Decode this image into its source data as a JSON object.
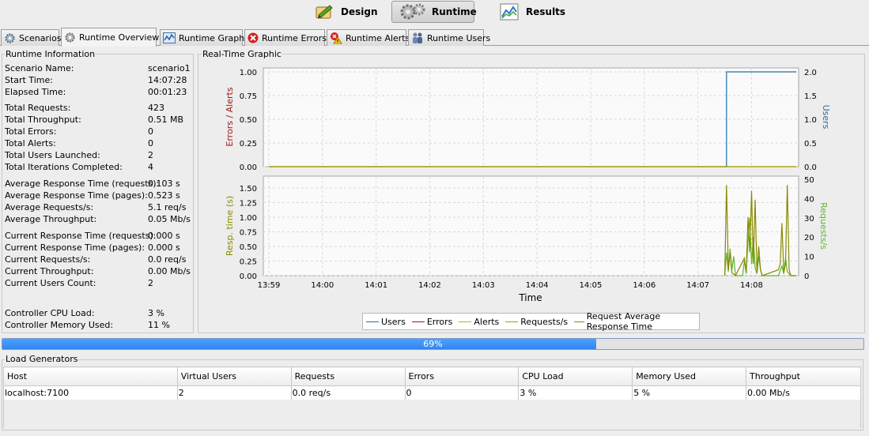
{
  "modes": [
    {
      "label": "Design",
      "icon": "design-icon",
      "active": false
    },
    {
      "label": "Runtime",
      "icon": "gears-icon",
      "active": true
    },
    {
      "label": "Results",
      "icon": "chart-icon",
      "active": false
    }
  ],
  "tabs": [
    {
      "label": "Scenarios",
      "icon": "gear-icon"
    },
    {
      "label": "Runtime Overview",
      "icon": "gear-icon",
      "active": true
    },
    {
      "label": "Runtime Graphs",
      "icon": "graph-icon"
    },
    {
      "label": "Runtime Errors",
      "icon": "error-icon"
    },
    {
      "label": "Runtime Alerts",
      "icon": "alert-icon"
    },
    {
      "label": "Runtime Users",
      "icon": "users-icon"
    }
  ],
  "runtime_info": {
    "title": "Runtime Information",
    "rows": [
      {
        "label": "Scenario Name:",
        "value": "scenario1"
      },
      {
        "label": "Start Time:",
        "value": "14:07:28"
      },
      {
        "label": "Elapsed Time:",
        "value": "00:01:23"
      },
      {
        "label": "Total Requests:",
        "value": "423"
      },
      {
        "label": "Total Throughput:",
        "value": "0.51 MB"
      },
      {
        "label": "Total Errors:",
        "value": "0"
      },
      {
        "label": "Total Alerts:",
        "value": "0"
      },
      {
        "label": "Total Users Launched:",
        "value": "2"
      },
      {
        "label": "Total Iterations Completed:",
        "value": "4"
      },
      {
        "label": "Average Response Time (requests):",
        "value": "0.103 s"
      },
      {
        "label": "Average Response Time (pages):",
        "value": "0.523 s"
      },
      {
        "label": "Average Requests/s:",
        "value": "5.1 req/s"
      },
      {
        "label": "Average Throughput:",
        "value": "0.05 Mb/s"
      },
      {
        "label": "Current Response Time (requests):",
        "value": "0.000 s"
      },
      {
        "label": "Current Response Time (pages):",
        "value": "0.000 s"
      },
      {
        "label": "Current Requests/s:",
        "value": "0.0 req/s"
      },
      {
        "label": "Current Throughput:",
        "value": "0.00 Mb/s"
      },
      {
        "label": "Current Users Count:",
        "value": "2"
      },
      {
        "label": "Controller CPU Load:",
        "value": "3 %"
      },
      {
        "label": "Controller Memory Used:",
        "value": "11 %"
      }
    ]
  },
  "graph": {
    "title": "Real-Time Graphic",
    "top_left_axis": "Errors / Alerts",
    "top_right_axis": "Users",
    "bottom_left_axis": "Resp. time (s)",
    "bottom_right_axis": "Requests/s",
    "x_axis_label": "Time",
    "top_left_ticks": [
      "0.00",
      "0.25",
      "0.50",
      "0.75",
      "1.00"
    ],
    "top_right_ticks": [
      "0.0",
      "0.5",
      "1.0",
      "1.5",
      "2.0"
    ],
    "bottom_left_ticks": [
      "0.00",
      "0.25",
      "0.50",
      "0.75",
      "1.00",
      "1.25",
      "1.50"
    ],
    "bottom_right_ticks": [
      "0",
      "10",
      "20",
      "30",
      "40",
      "50"
    ],
    "x_ticks": [
      "13:59",
      "14:00",
      "14:01",
      "14:02",
      "14:03",
      "14:04",
      "14:05",
      "14:06",
      "14:07",
      "14:08"
    ],
    "colors": {
      "users": "#1f6fa8",
      "errors": "#a01515",
      "alerts": "#b8b800",
      "requests": "#5fb82a",
      "resp": "#8a8a00"
    },
    "legend": [
      {
        "label": "Users",
        "color": "#1f6fa8"
      },
      {
        "label": "Errors",
        "color": "#a01515"
      },
      {
        "label": "Alerts",
        "color": "#b8b800"
      },
      {
        "label": "Requests/s",
        "color": "#5fb82a"
      },
      {
        "label": "Request Average Response Time",
        "color": "#8a8a00"
      }
    ]
  },
  "chart_data": {
    "type": "line",
    "title": "Real-Time Graphic",
    "xlabel": "Time",
    "x_range": [
      "13:59",
      "14:08:50"
    ],
    "panels": [
      {
        "ylabel_left": "Errors / Alerts",
        "ylabel_right": "Users",
        "ylim_left": [
          0,
          1
        ],
        "ylim_right": [
          0,
          2
        ],
        "series": [
          {
            "name": "Users",
            "axis": "right",
            "points": [
              [
                "13:59:00",
                0
              ],
              [
                "14:07:32",
                0
              ],
              [
                "14:07:32",
                2
              ],
              [
                "14:08:50",
                2
              ]
            ]
          },
          {
            "name": "Errors",
            "axis": "left",
            "points": [
              [
                "13:59:00",
                0
              ],
              [
                "14:08:50",
                0
              ]
            ]
          },
          {
            "name": "Alerts",
            "axis": "left",
            "points": [
              [
                "13:59:00",
                0
              ],
              [
                "14:08:50",
                0
              ]
            ]
          }
        ]
      },
      {
        "ylabel_left": "Resp. time (s)",
        "ylabel_right": "Requests/s",
        "ylim_left": [
          0,
          1.6
        ],
        "ylim_right": [
          0,
          50
        ],
        "series": [
          {
            "name": "Requests/s",
            "axis": "right",
            "points": [
              [
                "14:07:30",
                0
              ],
              [
                "14:07:32",
                12
              ],
              [
                "14:07:34",
                2
              ],
              [
                "14:07:36",
                14
              ],
              [
                "14:07:38",
                3
              ],
              [
                "14:07:40",
                10
              ],
              [
                "14:07:42",
                0
              ],
              [
                "14:07:50",
                0
              ],
              [
                "14:07:52",
                8
              ],
              [
                "14:07:54",
                1
              ],
              [
                "14:07:56",
                18
              ],
              [
                "14:07:58",
                30
              ],
              [
                "14:08:00",
                6
              ],
              [
                "14:08:02",
                20
              ],
              [
                "14:08:04",
                4
              ],
              [
                "14:08:06",
                1
              ],
              [
                "14:08:08",
                10
              ],
              [
                "14:08:10",
                3
              ],
              [
                "14:08:12",
                0
              ],
              [
                "14:08:30",
                0
              ],
              [
                "14:08:34",
                5
              ],
              [
                "14:08:36",
                1
              ],
              [
                "14:08:38",
                9
              ],
              [
                "14:08:40",
                2
              ],
              [
                "14:08:44",
                0
              ],
              [
                "14:08:50",
                0
              ]
            ]
          },
          {
            "name": "Request Average Response Time",
            "axis": "left",
            "points": [
              [
                "14:07:30",
                0
              ],
              [
                "14:07:32",
                1.55
              ],
              [
                "14:07:34",
                0.1
              ],
              [
                "14:07:36",
                0.4
              ],
              [
                "14:07:38",
                0.05
              ],
              [
                "14:07:42",
                0
              ],
              [
                "14:07:52",
                0.3
              ],
              [
                "14:07:54",
                0.05
              ],
              [
                "14:07:56",
                1.0
              ],
              [
                "14:07:58",
                0.4
              ],
              [
                "14:08:00",
                1.45
              ],
              [
                "14:08:02",
                0.2
              ],
              [
                "14:08:04",
                1.3
              ],
              [
                "14:08:06",
                0.05
              ],
              [
                "14:08:08",
                0.5
              ],
              [
                "14:08:10",
                0.1
              ],
              [
                "14:08:12",
                0
              ],
              [
                "14:08:30",
                0.1
              ],
              [
                "14:08:32",
                0.2
              ],
              [
                "14:08:34",
                0.9
              ],
              [
                "14:08:36",
                0.05
              ],
              [
                "14:08:38",
                0.2
              ],
              [
                "14:08:40",
                1.55
              ],
              [
                "14:08:42",
                0.1
              ],
              [
                "14:08:44",
                0
              ],
              [
                "14:08:50",
                0
              ]
            ]
          }
        ]
      }
    ],
    "legend": [
      "Users",
      "Errors",
      "Alerts",
      "Requests/s",
      "Request Average Response Time"
    ],
    "legend_position": "bottom",
    "grid": true
  },
  "progress": {
    "value": 0.69,
    "label": "69%"
  },
  "load_generators": {
    "title": "Load Generators",
    "columns": [
      "Host",
      "Virtual Users",
      "Requests",
      "Errors",
      "CPU Load",
      "Memory Used",
      "Throughput"
    ],
    "rows": [
      [
        "localhost:7100",
        "2",
        "0.0 req/s",
        "0",
        "3 %",
        "5 %",
        "0.00 Mb/s"
      ]
    ]
  }
}
